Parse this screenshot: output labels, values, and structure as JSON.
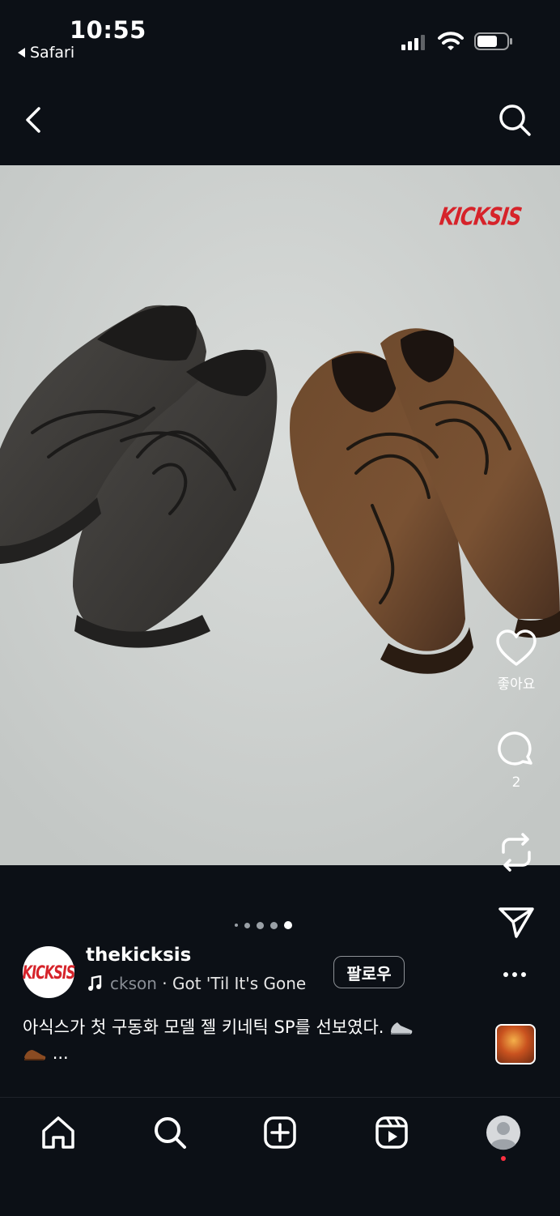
{
  "status_bar": {
    "time": "10:55",
    "back_app": "Safari"
  },
  "post": {
    "brand_watermark": "KICKSIS",
    "actions": {
      "like_label": "좋아요",
      "comment_count": "2"
    },
    "carousel": {
      "total": 5,
      "current": 5
    },
    "author": {
      "username": "thekicksis",
      "avatar_text": "KICKSIS",
      "music_faded": "ckson",
      "music_separator": "·",
      "music_title": "Got 'Til It's Gone"
    },
    "follow_label": "팔로우",
    "caption_text": "아식스가 첫 구동화 모델 젤 키네틱 SP를 선보였다.",
    "caption_more": "..."
  },
  "icons": {
    "nav": [
      "chevron-left-icon",
      "search-icon"
    ],
    "actions": [
      "heart-icon",
      "comment-icon",
      "repost-icon",
      "send-icon",
      "more-icon"
    ],
    "tabs": [
      "home-icon",
      "search-icon",
      "add-icon",
      "reels-icon",
      "profile-icon"
    ]
  },
  "colors": {
    "background": "#0c1016",
    "brand_red": "#d6232a",
    "notification": "#ff3040"
  }
}
